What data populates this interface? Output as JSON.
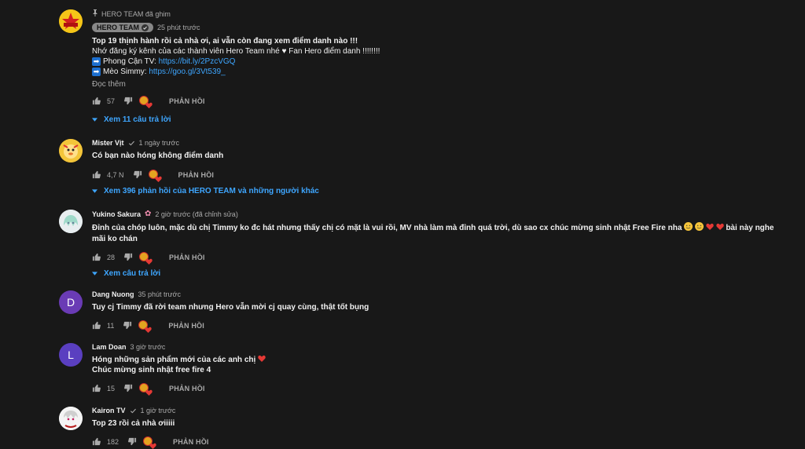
{
  "comments": [
    {
      "pinned_label": "HERO TEAM đã ghim",
      "author": "HERO TEAM",
      "time": "25 phút trước",
      "lines": [
        "Top 19 thịnh hành rồi cả nhà ơi, ai vẫn còn đang xem điểm danh nào !!!",
        "Nhớ đăng ký kênh của các thành viên Hero Team nhé ♥ Fan Hero điểm danh !!!!!!!!"
      ],
      "links": [
        {
          "label": "Phong Cận TV:",
          "url": "https://bit.ly/2PzcVGQ"
        },
        {
          "label": "Mèo Simmy:",
          "url": "https://goo.gl/3Vt539_"
        }
      ],
      "read_more": "Đọc thêm",
      "likes": "57",
      "reply_label": "PHẢN HỒI",
      "expand": "Xem 11 câu trả lời"
    },
    {
      "author": "Mister Vịt",
      "time": "1 ngày trước",
      "text": "Có bạn nào hóng không điểm danh",
      "likes": "4,7 N",
      "reply_label": "PHẢN HỒI",
      "expand": "Xem 396 phản hồi của HERO TEAM và những người khác"
    },
    {
      "author": "Yukino Sakura",
      "time": "2 giờ trước (đã chỉnh sửa)",
      "text": "Đỉnh của chóp luôn, mặc dù chị Timmy ko đc hát nhưng thấy chị có mặt là vui rồi, MV nhà làm mà đỉnh quá trời, dù sao cx chúc mừng sinh nhật Free Fire nha",
      "text_tail": "bài này nghe",
      "text_line2": "mãi ko chán",
      "likes": "28",
      "reply_label": "PHẢN HỒI",
      "expand": "Xem câu trả lời"
    },
    {
      "author": "Dang Nuong",
      "time": "35 phút trước",
      "initial": "D",
      "text": "Tuy cj Timmy đã rời team nhưng Hero vẫn mời cj quay cùng, thật tốt bụng",
      "likes": "11",
      "reply_label": "PHẢN HỒI"
    },
    {
      "author": "Lam Doan",
      "time": "3 giờ trước",
      "initial": "L",
      "text": "Hóng những sản phẩm mới của các anh chị",
      "text_line2": "Chúc mừng sinh nhật free fire 4",
      "likes": "15",
      "reply_label": "PHẢN HỒI"
    },
    {
      "author": "Kairon TV",
      "time": "1 giờ trước",
      "text": "Top 23 rồi cả nhà ơiiiii",
      "likes": "182",
      "reply_label": "PHẢN HỒI"
    }
  ],
  "colors": {
    "background": "#181818",
    "link": "#3ea6ff",
    "muted": "#aaaaaa",
    "avatar_d": "#6a3bb5",
    "avatar_l": "#5a3fc0",
    "heart": "#e53935"
  }
}
